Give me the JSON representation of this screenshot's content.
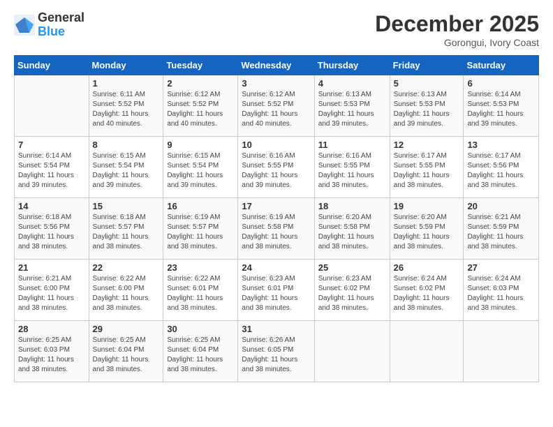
{
  "logo": {
    "general": "General",
    "blue": "Blue"
  },
  "header": {
    "month": "December 2025",
    "location": "Gorongui, Ivory Coast"
  },
  "weekdays": [
    "Sunday",
    "Monday",
    "Tuesday",
    "Wednesday",
    "Thursday",
    "Friday",
    "Saturday"
  ],
  "weeks": [
    [
      {
        "day": "",
        "info": ""
      },
      {
        "day": "1",
        "info": "Sunrise: 6:11 AM\nSunset: 5:52 PM\nDaylight: 11 hours\nand 40 minutes."
      },
      {
        "day": "2",
        "info": "Sunrise: 6:12 AM\nSunset: 5:52 PM\nDaylight: 11 hours\nand 40 minutes."
      },
      {
        "day": "3",
        "info": "Sunrise: 6:12 AM\nSunset: 5:52 PM\nDaylight: 11 hours\nand 40 minutes."
      },
      {
        "day": "4",
        "info": "Sunrise: 6:13 AM\nSunset: 5:53 PM\nDaylight: 11 hours\nand 39 minutes."
      },
      {
        "day": "5",
        "info": "Sunrise: 6:13 AM\nSunset: 5:53 PM\nDaylight: 11 hours\nand 39 minutes."
      },
      {
        "day": "6",
        "info": "Sunrise: 6:14 AM\nSunset: 5:53 PM\nDaylight: 11 hours\nand 39 minutes."
      }
    ],
    [
      {
        "day": "7",
        "info": "Sunrise: 6:14 AM\nSunset: 5:54 PM\nDaylight: 11 hours\nand 39 minutes."
      },
      {
        "day": "8",
        "info": "Sunrise: 6:15 AM\nSunset: 5:54 PM\nDaylight: 11 hours\nand 39 minutes."
      },
      {
        "day": "9",
        "info": "Sunrise: 6:15 AM\nSunset: 5:54 PM\nDaylight: 11 hours\nand 39 minutes."
      },
      {
        "day": "10",
        "info": "Sunrise: 6:16 AM\nSunset: 5:55 PM\nDaylight: 11 hours\nand 39 minutes."
      },
      {
        "day": "11",
        "info": "Sunrise: 6:16 AM\nSunset: 5:55 PM\nDaylight: 11 hours\nand 38 minutes."
      },
      {
        "day": "12",
        "info": "Sunrise: 6:17 AM\nSunset: 5:55 PM\nDaylight: 11 hours\nand 38 minutes."
      },
      {
        "day": "13",
        "info": "Sunrise: 6:17 AM\nSunset: 5:56 PM\nDaylight: 11 hours\nand 38 minutes."
      }
    ],
    [
      {
        "day": "14",
        "info": "Sunrise: 6:18 AM\nSunset: 5:56 PM\nDaylight: 11 hours\nand 38 minutes."
      },
      {
        "day": "15",
        "info": "Sunrise: 6:18 AM\nSunset: 5:57 PM\nDaylight: 11 hours\nand 38 minutes."
      },
      {
        "day": "16",
        "info": "Sunrise: 6:19 AM\nSunset: 5:57 PM\nDaylight: 11 hours\nand 38 minutes."
      },
      {
        "day": "17",
        "info": "Sunrise: 6:19 AM\nSunset: 5:58 PM\nDaylight: 11 hours\nand 38 minutes."
      },
      {
        "day": "18",
        "info": "Sunrise: 6:20 AM\nSunset: 5:58 PM\nDaylight: 11 hours\nand 38 minutes."
      },
      {
        "day": "19",
        "info": "Sunrise: 6:20 AM\nSunset: 5:59 PM\nDaylight: 11 hours\nand 38 minutes."
      },
      {
        "day": "20",
        "info": "Sunrise: 6:21 AM\nSunset: 5:59 PM\nDaylight: 11 hours\nand 38 minutes."
      }
    ],
    [
      {
        "day": "21",
        "info": "Sunrise: 6:21 AM\nSunset: 6:00 PM\nDaylight: 11 hours\nand 38 minutes."
      },
      {
        "day": "22",
        "info": "Sunrise: 6:22 AM\nSunset: 6:00 PM\nDaylight: 11 hours\nand 38 minutes."
      },
      {
        "day": "23",
        "info": "Sunrise: 6:22 AM\nSunset: 6:01 PM\nDaylight: 11 hours\nand 38 minutes."
      },
      {
        "day": "24",
        "info": "Sunrise: 6:23 AM\nSunset: 6:01 PM\nDaylight: 11 hours\nand 38 minutes."
      },
      {
        "day": "25",
        "info": "Sunrise: 6:23 AM\nSunset: 6:02 PM\nDaylight: 11 hours\nand 38 minutes."
      },
      {
        "day": "26",
        "info": "Sunrise: 6:24 AM\nSunset: 6:02 PM\nDaylight: 11 hours\nand 38 minutes."
      },
      {
        "day": "27",
        "info": "Sunrise: 6:24 AM\nSunset: 6:03 PM\nDaylight: 11 hours\nand 38 minutes."
      }
    ],
    [
      {
        "day": "28",
        "info": "Sunrise: 6:25 AM\nSunset: 6:03 PM\nDaylight: 11 hours\nand 38 minutes."
      },
      {
        "day": "29",
        "info": "Sunrise: 6:25 AM\nSunset: 6:04 PM\nDaylight: 11 hours\nand 38 minutes."
      },
      {
        "day": "30",
        "info": "Sunrise: 6:25 AM\nSunset: 6:04 PM\nDaylight: 11 hours\nand 38 minutes."
      },
      {
        "day": "31",
        "info": "Sunrise: 6:26 AM\nSunset: 6:05 PM\nDaylight: 11 hours\nand 38 minutes."
      },
      {
        "day": "",
        "info": ""
      },
      {
        "day": "",
        "info": ""
      },
      {
        "day": "",
        "info": ""
      }
    ]
  ]
}
